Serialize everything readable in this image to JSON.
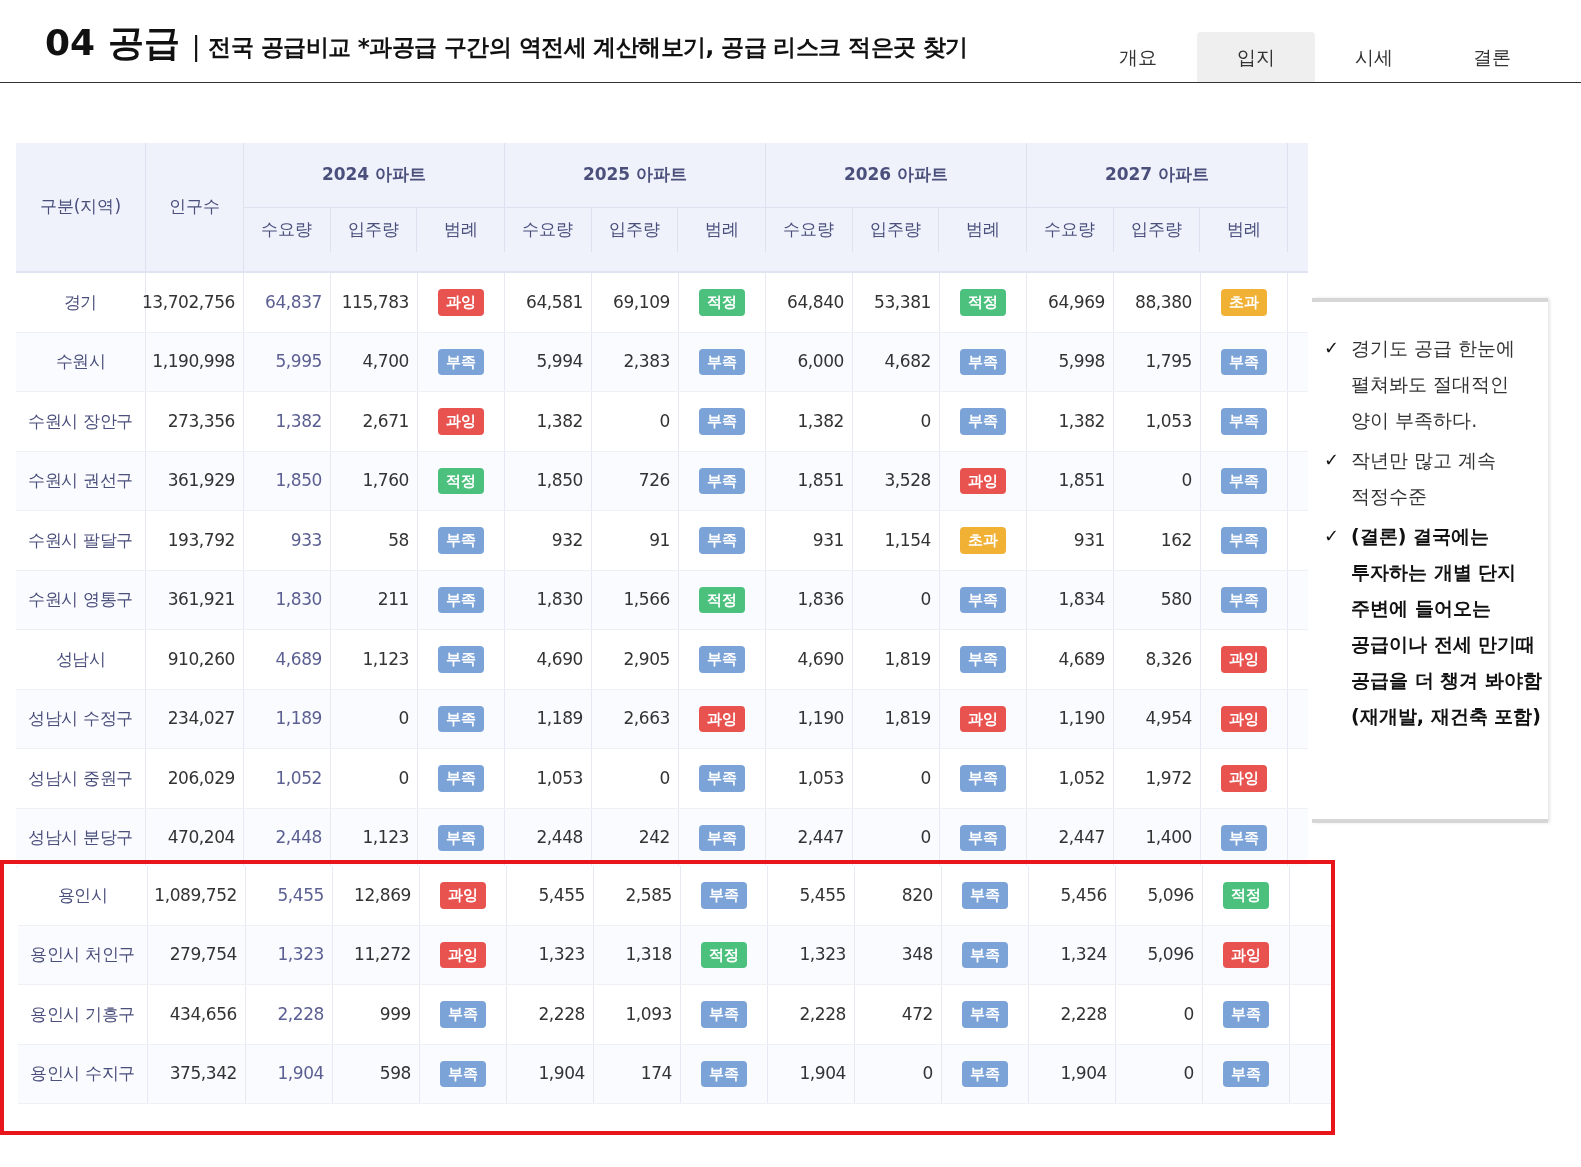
{
  "header": {
    "section": "04 공급",
    "divider": "|",
    "subtitle": "전국 공급비교 *과공급 구간의 역전세 계산해보기, 공급 리스크 적은곳 찾기"
  },
  "tabs": [
    {
      "label": "개요",
      "selected": false
    },
    {
      "label": "입지",
      "selected": true
    },
    {
      "label": "시세",
      "selected": false
    },
    {
      "label": "결론",
      "selected": false
    }
  ],
  "table": {
    "columns": {
      "region": "구분(지역)",
      "population": "인구수",
      "years": [
        {
          "title": "2024 아파트",
          "sub": [
            "수요량",
            "입주량",
            "범례"
          ]
        },
        {
          "title": "2025 아파트",
          "sub": [
            "수요량",
            "입주량",
            "범례"
          ]
        },
        {
          "title": "2026 아파트",
          "sub": [
            "수요량",
            "입주량",
            "범례"
          ]
        },
        {
          "title": "2027 아파트",
          "sub": [
            "수요량",
            "입주량",
            "범례"
          ]
        }
      ]
    },
    "rows": [
      {
        "region": "경기",
        "population": "13,702,756",
        "years": [
          {
            "demand": "64,837",
            "supply": "115,783",
            "badge": {
              "label": "과잉",
              "kind": "over"
            }
          },
          {
            "demand": "64,581",
            "supply": "69,109",
            "badge": {
              "label": "적정",
              "kind": "fit"
            }
          },
          {
            "demand": "64,840",
            "supply": "53,381",
            "badge": {
              "label": "적정",
              "kind": "fit"
            }
          },
          {
            "demand": "64,969",
            "supply": "88,380",
            "badge": {
              "label": "초과",
              "kind": "excess"
            }
          }
        ]
      },
      {
        "region": "수원시",
        "population": "1,190,998",
        "years": [
          {
            "demand": "5,995",
            "supply": "4,700",
            "badge": {
              "label": "부족",
              "kind": "short"
            }
          },
          {
            "demand": "5,994",
            "supply": "2,383",
            "badge": {
              "label": "부족",
              "kind": "short"
            }
          },
          {
            "demand": "6,000",
            "supply": "4,682",
            "badge": {
              "label": "부족",
              "kind": "short"
            }
          },
          {
            "demand": "5,998",
            "supply": "1,795",
            "badge": {
              "label": "부족",
              "kind": "short"
            }
          }
        ]
      },
      {
        "region": "수원시 장안구",
        "population": "273,356",
        "years": [
          {
            "demand": "1,382",
            "supply": "2,671",
            "badge": {
              "label": "과잉",
              "kind": "over"
            }
          },
          {
            "demand": "1,382",
            "supply": "0",
            "badge": {
              "label": "부족",
              "kind": "short"
            }
          },
          {
            "demand": "1,382",
            "supply": "0",
            "badge": {
              "label": "부족",
              "kind": "short"
            }
          },
          {
            "demand": "1,382",
            "supply": "1,053",
            "badge": {
              "label": "부족",
              "kind": "short"
            }
          }
        ]
      },
      {
        "region": "수원시 권선구",
        "population": "361,929",
        "years": [
          {
            "demand": "1,850",
            "supply": "1,760",
            "badge": {
              "label": "적정",
              "kind": "fit"
            }
          },
          {
            "demand": "1,850",
            "supply": "726",
            "badge": {
              "label": "부족",
              "kind": "short"
            }
          },
          {
            "demand": "1,851",
            "supply": "3,528",
            "badge": {
              "label": "과잉",
              "kind": "over"
            }
          },
          {
            "demand": "1,851",
            "supply": "0",
            "badge": {
              "label": "부족",
              "kind": "short"
            }
          }
        ]
      },
      {
        "region": "수원시 팔달구",
        "population": "193,792",
        "years": [
          {
            "demand": "933",
            "supply": "58",
            "badge": {
              "label": "부족",
              "kind": "short"
            }
          },
          {
            "demand": "932",
            "supply": "91",
            "badge": {
              "label": "부족",
              "kind": "short"
            }
          },
          {
            "demand": "931",
            "supply": "1,154",
            "badge": {
              "label": "초과",
              "kind": "excess"
            }
          },
          {
            "demand": "931",
            "supply": "162",
            "badge": {
              "label": "부족",
              "kind": "short"
            }
          }
        ]
      },
      {
        "region": "수원시 영통구",
        "population": "361,921",
        "years": [
          {
            "demand": "1,830",
            "supply": "211",
            "badge": {
              "label": "부족",
              "kind": "short"
            }
          },
          {
            "demand": "1,830",
            "supply": "1,566",
            "badge": {
              "label": "적정",
              "kind": "fit"
            }
          },
          {
            "demand": "1,836",
            "supply": "0",
            "badge": {
              "label": "부족",
              "kind": "short"
            }
          },
          {
            "demand": "1,834",
            "supply": "580",
            "badge": {
              "label": "부족",
              "kind": "short"
            }
          }
        ]
      },
      {
        "region": "성남시",
        "population": "910,260",
        "years": [
          {
            "demand": "4,689",
            "supply": "1,123",
            "badge": {
              "label": "부족",
              "kind": "short"
            }
          },
          {
            "demand": "4,690",
            "supply": "2,905",
            "badge": {
              "label": "부족",
              "kind": "short"
            }
          },
          {
            "demand": "4,690",
            "supply": "1,819",
            "badge": {
              "label": "부족",
              "kind": "short"
            }
          },
          {
            "demand": "4,689",
            "supply": "8,326",
            "badge": {
              "label": "과잉",
              "kind": "over"
            }
          }
        ]
      },
      {
        "region": "성남시 수정구",
        "population": "234,027",
        "years": [
          {
            "demand": "1,189",
            "supply": "0",
            "badge": {
              "label": "부족",
              "kind": "short"
            }
          },
          {
            "demand": "1,189",
            "supply": "2,663",
            "badge": {
              "label": "과잉",
              "kind": "over"
            }
          },
          {
            "demand": "1,190",
            "supply": "1,819",
            "badge": {
              "label": "과잉",
              "kind": "over"
            }
          },
          {
            "demand": "1,190",
            "supply": "4,954",
            "badge": {
              "label": "과잉",
              "kind": "over"
            }
          }
        ]
      },
      {
        "region": "성남시 중원구",
        "population": "206,029",
        "years": [
          {
            "demand": "1,052",
            "supply": "0",
            "badge": {
              "label": "부족",
              "kind": "short"
            }
          },
          {
            "demand": "1,053",
            "supply": "0",
            "badge": {
              "label": "부족",
              "kind": "short"
            }
          },
          {
            "demand": "1,053",
            "supply": "0",
            "badge": {
              "label": "부족",
              "kind": "short"
            }
          },
          {
            "demand": "1,052",
            "supply": "1,972",
            "badge": {
              "label": "과잉",
              "kind": "over"
            }
          }
        ]
      },
      {
        "region": "성남시 분당구",
        "population": "470,204",
        "years": [
          {
            "demand": "2,448",
            "supply": "1,123",
            "badge": {
              "label": "부족",
              "kind": "short"
            }
          },
          {
            "demand": "2,448",
            "supply": "242",
            "badge": {
              "label": "부족",
              "kind": "short"
            }
          },
          {
            "demand": "2,447",
            "supply": "0",
            "badge": {
              "label": "부족",
              "kind": "short"
            }
          },
          {
            "demand": "2,447",
            "supply": "1,400",
            "badge": {
              "label": "부족",
              "kind": "short"
            }
          }
        ]
      }
    ],
    "highlighted_rows": [
      {
        "region": "용인시",
        "population": "1,089,752",
        "years": [
          {
            "demand": "5,455",
            "supply": "12,869",
            "badge": {
              "label": "과잉",
              "kind": "over"
            }
          },
          {
            "demand": "5,455",
            "supply": "2,585",
            "badge": {
              "label": "부족",
              "kind": "short"
            }
          },
          {
            "demand": "5,455",
            "supply": "820",
            "badge": {
              "label": "부족",
              "kind": "short"
            }
          },
          {
            "demand": "5,456",
            "supply": "5,096",
            "badge": {
              "label": "적정",
              "kind": "fit"
            }
          }
        ]
      },
      {
        "region": "용인시 처인구",
        "population": "279,754",
        "years": [
          {
            "demand": "1,323",
            "supply": "11,272",
            "badge": {
              "label": "과잉",
              "kind": "over"
            }
          },
          {
            "demand": "1,323",
            "supply": "1,318",
            "badge": {
              "label": "적정",
              "kind": "fit"
            }
          },
          {
            "demand": "1,323",
            "supply": "348",
            "badge": {
              "label": "부족",
              "kind": "short"
            }
          },
          {
            "demand": "1,324",
            "supply": "5,096",
            "badge": {
              "label": "과잉",
              "kind": "over"
            }
          }
        ]
      },
      {
        "region": "용인시 기흥구",
        "population": "434,656",
        "years": [
          {
            "demand": "2,228",
            "supply": "999",
            "badge": {
              "label": "부족",
              "kind": "short"
            }
          },
          {
            "demand": "2,228",
            "supply": "1,093",
            "badge": {
              "label": "부족",
              "kind": "short"
            }
          },
          {
            "demand": "2,228",
            "supply": "472",
            "badge": {
              "label": "부족",
              "kind": "short"
            }
          },
          {
            "demand": "2,228",
            "supply": "0",
            "badge": {
              "label": "부족",
              "kind": "short"
            }
          }
        ]
      },
      {
        "region": "용인시 수지구",
        "population": "375,342",
        "years": [
          {
            "demand": "1,904",
            "supply": "598",
            "badge": {
              "label": "부족",
              "kind": "short"
            }
          },
          {
            "demand": "1,904",
            "supply": "174",
            "badge": {
              "label": "부족",
              "kind": "short"
            }
          },
          {
            "demand": "1,904",
            "supply": "0",
            "badge": {
              "label": "부족",
              "kind": "short"
            }
          },
          {
            "demand": "1,904",
            "supply": "0",
            "badge": {
              "label": "부족",
              "kind": "short"
            }
          }
        ]
      }
    ]
  },
  "notes": [
    {
      "mark": "✓",
      "text": "경기도 공급 한눈에 펼쳐봐도 절대적인 양이 부족하다.",
      "emphasis": false
    },
    {
      "mark": "✓",
      "text": "작년만 많고 계속 적정수준",
      "emphasis": false
    },
    {
      "mark": "✓",
      "text": "(결론) 결국에는 투자하는 개별 단지 주변에 들어오는 공급이나 전세 만기때 공급을 더 챙겨 봐야함(재개발, 재건축 포함)",
      "emphasis": true
    }
  ]
}
